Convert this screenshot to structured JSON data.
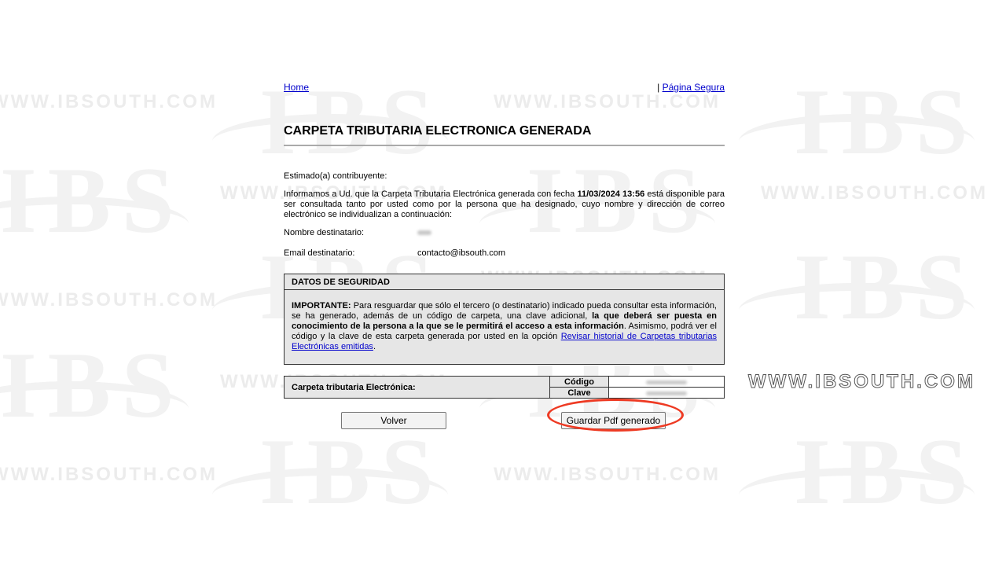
{
  "nav": {
    "home": "Home",
    "secure_sep": "|",
    "secure": "Página Segura"
  },
  "title": "CARPETA TRIBUTARIA ELECTRONICA GENERADA",
  "greeting": "Estimado(a) contribuyente:",
  "inform": {
    "before": "Informamos a Ud. que la Carpeta Tributaria Electrónica generada con fecha ",
    "date": "11/03/2024 13:56",
    "after": " está disponible para ser consultada tanto por usted como por la persona que ha designado, cuyo nombre y dirección de correo electrónico se individualizan a continuación:"
  },
  "recipient": {
    "name_label": "Nombre destinatario:",
    "email_label": "Email destinatario:",
    "email_value": "contacto@ibsouth.com"
  },
  "security": {
    "header": "DATOS DE SEGURIDAD",
    "important": "IMPORTANTE:",
    "text1": " Para resguardar que sólo el tercero (o destinatario) indicado pueda consultar esta información, se ha generado, además de un código de carpeta, una clave adicional, ",
    "bold": "la que deberá ser puesta en conocimiento de la persona a la que se le permitirá el acceso a esta información",
    "text2": ". Asimismo, podrá ver el código y la clave de esta carpeta generada por usted en la opción ",
    "link": "Revisar historial de Carpetas tributarias Electrónicas emitidas",
    "end": "."
  },
  "carpeta": {
    "label": "Carpeta tributaria Electrónica:",
    "code_label": "Código",
    "key_label": "Clave"
  },
  "buttons": {
    "volver": "Volver",
    "pdf": "Guardar Pdf generado"
  },
  "watermark": {
    "logo": "IBS",
    "url": "WWW.IBSOUTH.COM"
  },
  "colors": {
    "highlight": "#ee3a23",
    "link": "#0000cc",
    "box_bg": "#e6e6e6"
  }
}
